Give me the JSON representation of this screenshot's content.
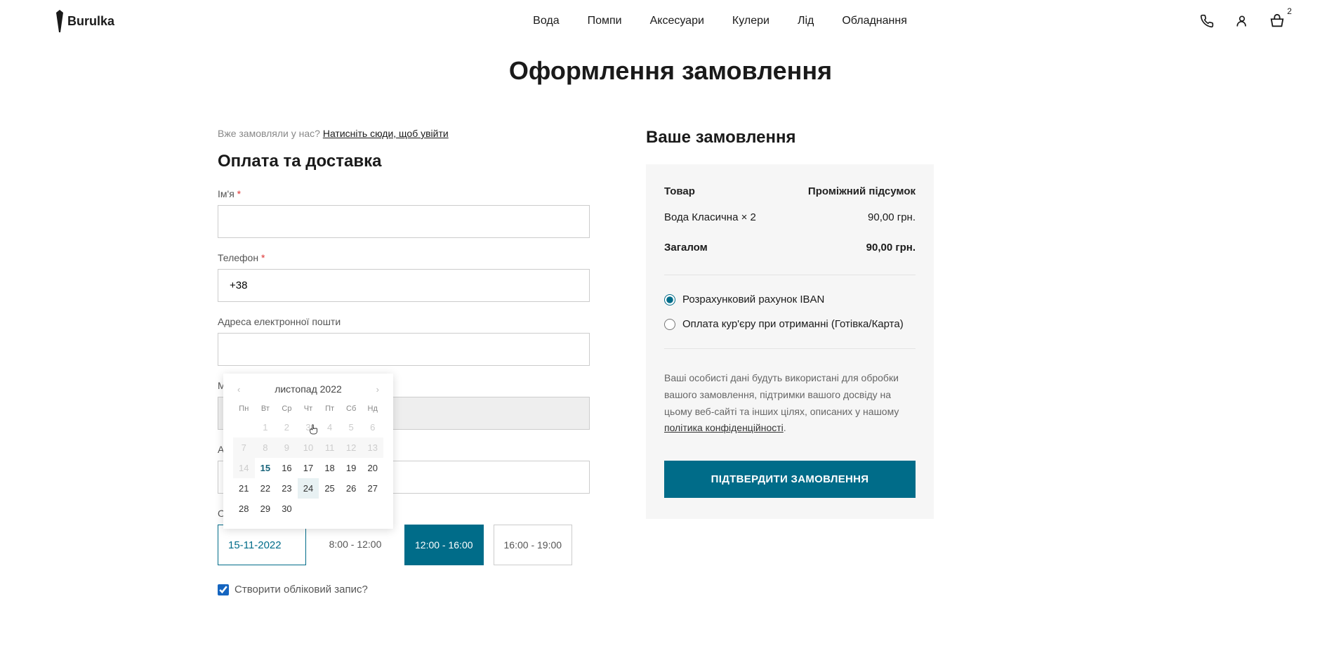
{
  "header": {
    "logo": "Burulka",
    "nav": [
      "Вода",
      "Помпи",
      "Аксесуари",
      "Кулери",
      "Лід",
      "Обладнання"
    ],
    "basket_count": "2"
  },
  "page_title": "Оформлення замовлення",
  "login_prompt": {
    "text": "Вже замовляли у нас? ",
    "link": "Натисніть сюди, щоб увійти"
  },
  "form": {
    "section_title": "Оплата та доставка",
    "name_label": "Ім'я",
    "phone_label": "Телефон",
    "phone_value": "+38",
    "email_label": "Адреса електронної пошти",
    "city_label": "М",
    "address_label": "А",
    "date_slot_label": "О",
    "date_value": "15-11-2022",
    "time_slots": [
      "8:00 - 12:00",
      "12:00 - 16:00",
      "16:00 - 19:00"
    ],
    "selected_slot_index": 1,
    "create_account_label": "Створити обліковий запис?"
  },
  "datepicker": {
    "month_label": "листопад 2022",
    "dow": [
      "Пн",
      "Вт",
      "Ср",
      "Чт",
      "Пт",
      "Сб",
      "Нд"
    ],
    "lead_blanks": 1,
    "days": [
      {
        "d": 1,
        "cls": "disabled"
      },
      {
        "d": 2,
        "cls": "disabled"
      },
      {
        "d": 3,
        "cls": "disabled"
      },
      {
        "d": 4,
        "cls": "disabled"
      },
      {
        "d": 5,
        "cls": "disabled"
      },
      {
        "d": 6,
        "cls": "disabled"
      },
      {
        "d": 7,
        "cls": "disabled-box"
      },
      {
        "d": 8,
        "cls": "disabled-box"
      },
      {
        "d": 9,
        "cls": "disabled-box"
      },
      {
        "d": 10,
        "cls": "disabled-box"
      },
      {
        "d": 11,
        "cls": "disabled-box"
      },
      {
        "d": 12,
        "cls": "disabled-box"
      },
      {
        "d": 13,
        "cls": "disabled-box"
      },
      {
        "d": 14,
        "cls": "disabled-box"
      },
      {
        "d": 15,
        "cls": "today"
      },
      {
        "d": 16,
        "cls": ""
      },
      {
        "d": 17,
        "cls": ""
      },
      {
        "d": 18,
        "cls": ""
      },
      {
        "d": 19,
        "cls": ""
      },
      {
        "d": 20,
        "cls": ""
      },
      {
        "d": 21,
        "cls": ""
      },
      {
        "d": 22,
        "cls": ""
      },
      {
        "d": 23,
        "cls": ""
      },
      {
        "d": 24,
        "cls": "hovered"
      },
      {
        "d": 25,
        "cls": ""
      },
      {
        "d": 26,
        "cls": ""
      },
      {
        "d": 27,
        "cls": ""
      },
      {
        "d": 28,
        "cls": ""
      },
      {
        "d": 29,
        "cls": ""
      },
      {
        "d": 30,
        "cls": ""
      }
    ]
  },
  "order": {
    "section_title": "Ваше замовлення",
    "head_product": "Товар",
    "head_subtotal": "Проміжний підсумок",
    "item_name": "Вода Класична  × 2",
    "item_price": "90,00 грн.",
    "total_label": "Загалом",
    "total_value": "90,00 грн.",
    "payment_iban": "Розрахунковий рахунок IBAN",
    "payment_cod": "Оплата кур'єру при отриманні (Готівка/Карта)",
    "privacy_text": "Ваші особисті дані будуть використані для обробки вашого замовлення, підтримки вашого досвіду на цьому веб-сайті та інших цілях, описаних у нашому ",
    "privacy_link": "політика конфіденційності",
    "confirm_label": "ПІДТВЕРДИТИ ЗАМОВЛЕННЯ"
  }
}
